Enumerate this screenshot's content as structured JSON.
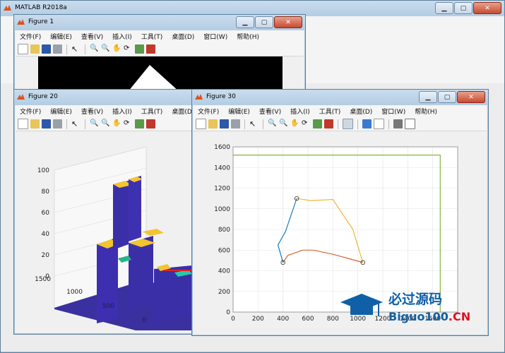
{
  "matlab": {
    "title": "MATLAB R2018a"
  },
  "menu": [
    "文件(F)",
    "编辑(E)",
    "查看(V)",
    "插入(I)",
    "工具(T)",
    "桌面(D)",
    "窗口(W)",
    "帮助(H)"
  ],
  "fig1": {
    "title": "Figure 1"
  },
  "fig20": {
    "title": "Figure 20",
    "zticks": [
      "100",
      "80",
      "60",
      "40",
      "20",
      "0"
    ],
    "yticks": [
      "1500",
      "1000",
      "500",
      "0"
    ],
    "xticks": [
      "5"
    ]
  },
  "fig30": {
    "title": "Figure 30"
  },
  "chart_data": {
    "type": "line",
    "xlim": [
      0,
      1800
    ],
    "ylim": [
      0,
      1600
    ],
    "xticks": [
      0,
      200,
      400,
      600,
      800,
      1000,
      1200,
      1400,
      1600
    ],
    "xtick_labels": [
      "0",
      "200",
      "400",
      "600",
      "800",
      "1000",
      "1200",
      "1400",
      "1600"
    ],
    "yticks": [
      0,
      200,
      400,
      600,
      800,
      1000,
      1200,
      1400,
      1600
    ],
    "ytick_labels": [
      "0",
      "200",
      "400",
      "600",
      "800",
      "1000",
      "1200",
      "1400",
      "1600"
    ],
    "grid": true,
    "series": [
      {
        "color": "#0072bd",
        "x": [
          400,
          360,
          420,
          510
        ],
        "y": [
          480,
          650,
          780,
          1100
        ]
      },
      {
        "color": "#d95319",
        "x": [
          400,
          440,
          560,
          640,
          800,
          1040
        ],
        "y": [
          480,
          550,
          600,
          600,
          560,
          480
        ]
      },
      {
        "color": "#edb120",
        "x": [
          510,
          620,
          800,
          960,
          1040
        ],
        "y": [
          1100,
          1080,
          1090,
          800,
          480
        ]
      },
      {
        "color": "#77ac30",
        "x": [
          0,
          1660,
          1660
        ],
        "y": [
          1520,
          1520,
          0
        ]
      }
    ],
    "markers": [
      {
        "x": 510,
        "y": 1100
      },
      {
        "x": 400,
        "y": 480
      },
      {
        "x": 1040,
        "y": 480
      }
    ]
  },
  "watermark": {
    "text_top": "必过源码",
    "text_bottom": "Biguo100",
    "suffix": ".CN"
  },
  "colors": {
    "accent_blue": "#1060a8",
    "watermark_red": "#e01020"
  }
}
